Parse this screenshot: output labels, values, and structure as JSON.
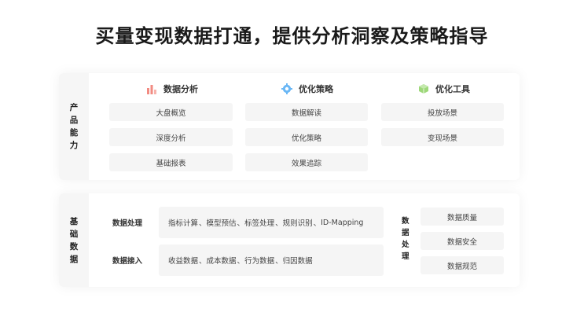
{
  "title": "买量变现数据打通，提供分析洞察及策略指导",
  "top_section": {
    "side_label": [
      "产",
      "品",
      "能",
      "力"
    ],
    "columns": [
      {
        "icon": "bar-chart-icon",
        "heading": "数据分析",
        "items": [
          "大盘概览",
          "深度分析",
          "基础报表"
        ]
      },
      {
        "icon": "gear-icon",
        "heading": "优化策略",
        "items": [
          "数据解读",
          "优化策略",
          "效果追踪"
        ]
      },
      {
        "icon": "cube-icon",
        "heading": "优化工具",
        "items": [
          "投放场景",
          "变现场景"
        ]
      }
    ]
  },
  "bottom_section": {
    "side_label": [
      "基",
      "础",
      "数",
      "据"
    ],
    "rows": [
      {
        "label": "数据处理",
        "items": [
          "指标计算",
          "模型预估",
          "标签处理",
          "规则识别",
          "ID-Mapping"
        ]
      },
      {
        "label": "数据接入",
        "items": [
          "收益数据",
          "成本数据",
          "行为数据",
          "归因数据"
        ]
      }
    ],
    "right_label": [
      "数",
      "据",
      "处",
      "理"
    ],
    "right_items": [
      "数据质量",
      "数据安全",
      "数据规范"
    ]
  },
  "colors": {
    "bar_icon": "#f28b82",
    "gear_icon": "#6ab7f5",
    "cube_icon": "#9ed87a"
  }
}
